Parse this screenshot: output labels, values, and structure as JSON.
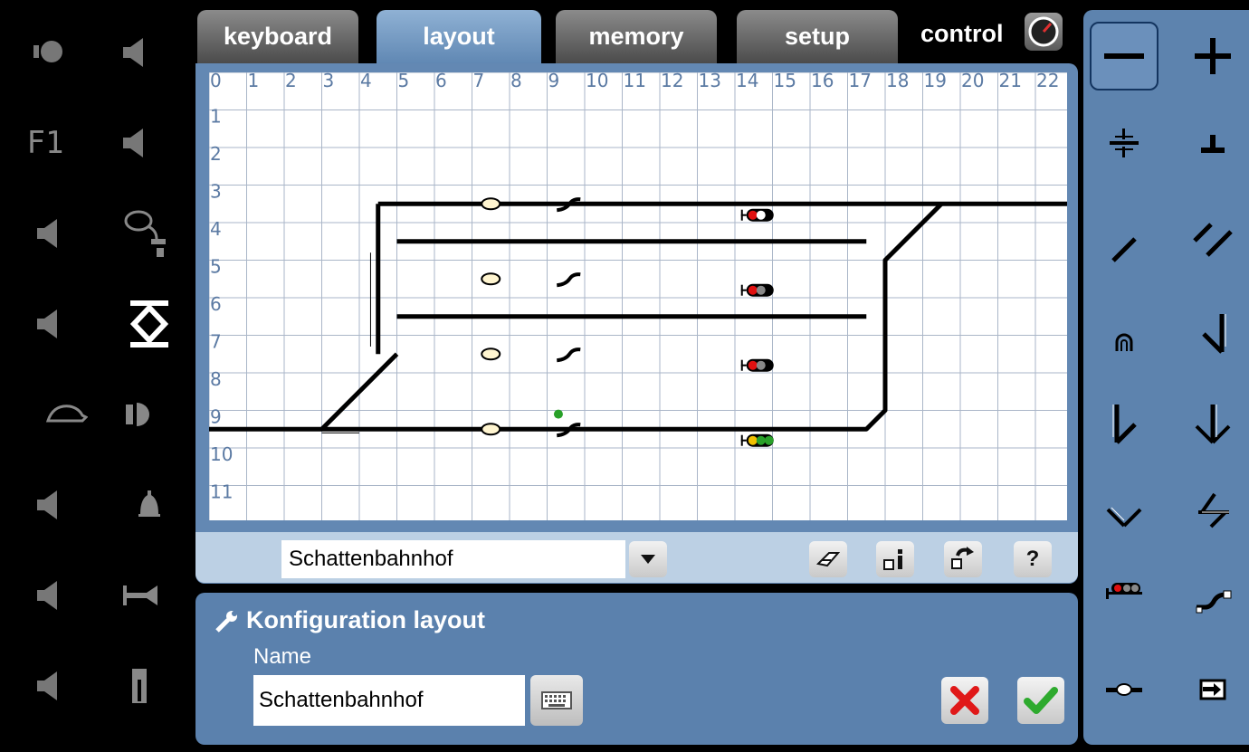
{
  "tabs": [
    {
      "label": "keyboard"
    },
    {
      "label": "layout"
    },
    {
      "label": "memory"
    },
    {
      "label": "setup"
    }
  ],
  "control_label": "control",
  "grid": {
    "col_labels": [
      "0",
      "1",
      "2",
      "3",
      "4",
      "5",
      "6",
      "7",
      "8",
      "9",
      "10",
      "11",
      "12",
      "13",
      "14",
      "15",
      "16",
      "17",
      "18",
      "19",
      "20",
      "21",
      "22"
    ],
    "row_labels": [
      "1",
      "2",
      "3",
      "4",
      "5",
      "6",
      "7",
      "8",
      "9",
      "10",
      "11"
    ]
  },
  "layout_select": {
    "value": "Schattenbahnhof"
  },
  "config": {
    "title": "Konfiguration layout",
    "name_label": "Name",
    "name_value": "Schattenbahnhof"
  },
  "function_keys": {
    "f1_label": "F1"
  },
  "toolbar": {
    "help_label": "?"
  },
  "colors": {
    "panel_blue": "#6388b3",
    "tab_active": "#7aa0c8",
    "signal_red": "#e01010",
    "signal_yellow": "#f0c000",
    "signal_green": "#28a028"
  }
}
